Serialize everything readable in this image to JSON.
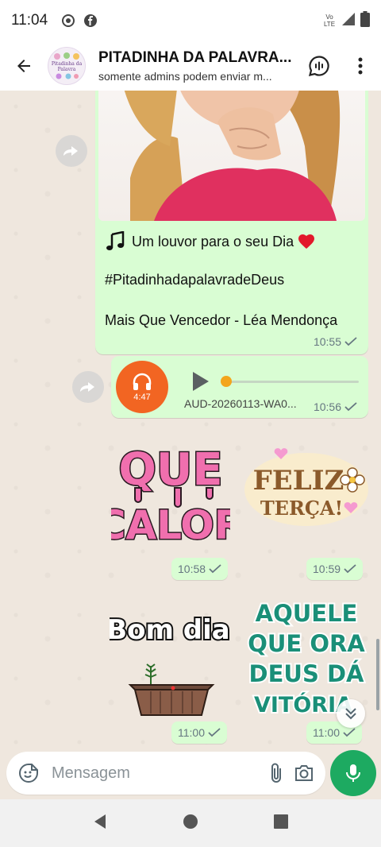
{
  "status_bar": {
    "time": "11:04",
    "network_label": "Vo LTE"
  },
  "header": {
    "title": "PITADINHA DA PALAVRA...",
    "subtitle": "somente admins podem enviar m...",
    "avatar_text": "Pitadinha da Palavra"
  },
  "messages": {
    "image_caption": {
      "line1": "Um louvor para o seu Dia",
      "line2": "#PitadinhadapalavradeDeus",
      "line3": "Mais Que Vencedor - Léa Mendonça",
      "time": "10:55"
    },
    "audio": {
      "duration": "4:47",
      "filename": "AUD-20260113-WA0...",
      "time": "10:56"
    },
    "stickers": [
      {
        "text_line1": "QUE",
        "text_line2": "CALOR",
        "time": "10:58"
      },
      {
        "text_line1": "FELIZ",
        "text_line2": "TERÇA!",
        "time": "10:59"
      },
      {
        "text_line1": "Bom dia",
        "time": "11:00"
      },
      {
        "text_line1": "AQUELE",
        "text_line2": "QUE ORA",
        "text_line3": "DEUS DÁ",
        "text_line4": "VITÓRIA",
        "time": "11:00"
      }
    ]
  },
  "composer": {
    "placeholder": "Mensagem"
  },
  "colors": {
    "bubble": "#d9fdd3",
    "accent_green": "#1daa61",
    "chat_bg": "#efe7de",
    "audio_avatar": "#f26522",
    "sticker_pink": "#f06fae",
    "sticker_brown": "#8b5a2b",
    "sticker_teal": "#1a8f78"
  }
}
